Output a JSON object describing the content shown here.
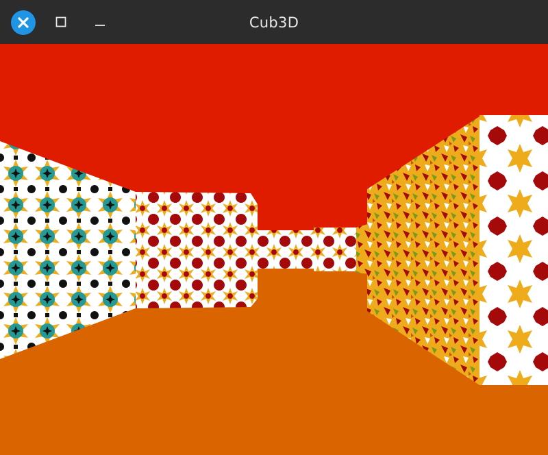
{
  "window": {
    "title": "Cub3D"
  },
  "controls": {
    "close_icon": "close-icon",
    "maximize_icon": "maximize-icon",
    "minimize_icon": "minimize-icon"
  },
  "scene": {
    "ceiling_color": "#e01c00",
    "floor_color": "#d96400",
    "tile_colors": {
      "white": "#ffffff",
      "teal": "#259a95",
      "black": "#111111",
      "gold": "#eeac1c",
      "crimson": "#a50a0a",
      "olive": "#7b9a1a"
    }
  }
}
